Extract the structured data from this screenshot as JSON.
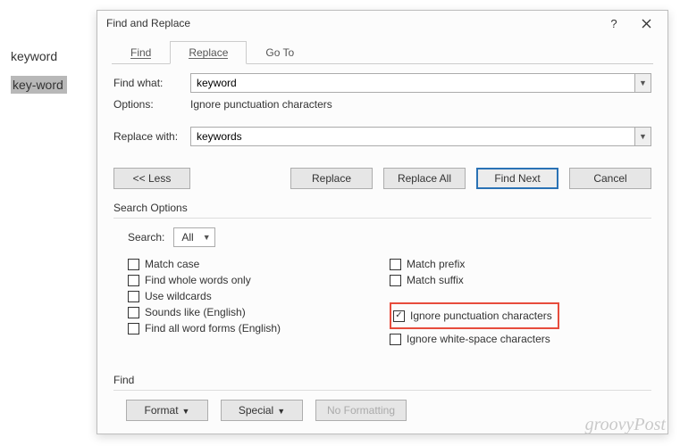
{
  "doc": {
    "word1": "keyword",
    "word2": "key-word"
  },
  "dialog": {
    "title": "Find and Replace",
    "tabs": {
      "find": "Find",
      "replace": "Replace",
      "goto": "Go To"
    },
    "find_what_label": "Find what:",
    "find_what_value": "keyword",
    "options_label": "Options:",
    "options_value": "Ignore punctuation characters",
    "replace_with_label": "Replace with:",
    "replace_with_value": "keywords",
    "buttons": {
      "less": "<< Less",
      "replace": "Replace",
      "replace_all": "Replace All",
      "find_next": "Find Next",
      "cancel": "Cancel"
    },
    "search_options_label": "Search Options",
    "search_label": "Search:",
    "search_value": "All",
    "checks": {
      "match_case": "Match case",
      "whole_words": "Find whole words only",
      "wildcards": "Use wildcards",
      "sounds_like": "Sounds like (English)",
      "word_forms": "Find all word forms (English)",
      "match_prefix": "Match prefix",
      "match_suffix": "Match suffix",
      "ignore_punct": "Ignore punctuation characters",
      "ignore_white": "Ignore white-space characters"
    },
    "find_label": "Find",
    "footer": {
      "format": "Format",
      "special": "Special",
      "no_formatting": "No Formatting"
    }
  },
  "watermark": "groovyPost"
}
